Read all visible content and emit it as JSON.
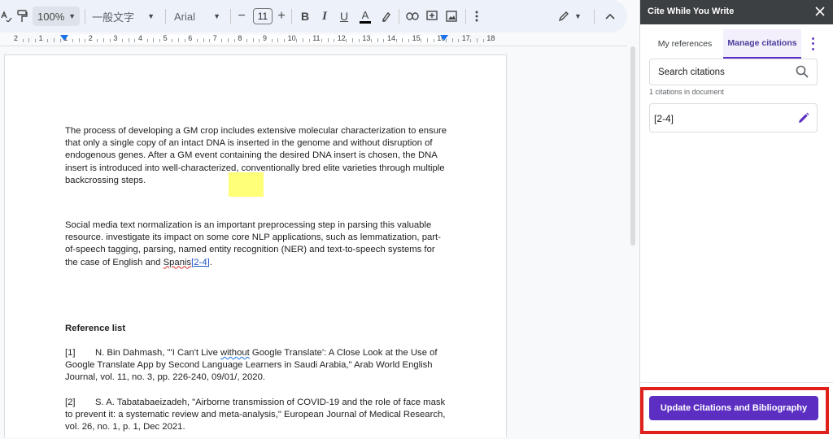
{
  "toolbar": {
    "zoom": "100%",
    "paragraph_style": "一般文字",
    "font": "Arial",
    "font_size": "11",
    "bold": "B",
    "italic": "I",
    "underline": "U",
    "text_color": "A"
  },
  "ruler": {
    "ticks": [
      "2",
      "1",
      "1",
      "2",
      "3",
      "4",
      "5",
      "6",
      "7",
      "8",
      "9",
      "10",
      "11",
      "12",
      "13",
      "14",
      "15",
      "16",
      "17",
      "18"
    ]
  },
  "document": {
    "paragraph1": "The process of developing a GM crop includes extensive molecular characterization to ensure that only a single copy of an intact DNA is inserted in the genome and without disruption of endogenous genes. After a GM event containing the desired DNA insert is chosen, the DNA insert is introduced into well-characterized, conventionally bred elite varieties through multiple backcrossing steps.",
    "paragraph2_before": "Social media text normalization is an important preprocessing step in parsing this valuable resource. investigate its impact on some core NLP applications, such as lemmatization, part-of-speech tagging, parsing, named entity recognition (NER) and text-to-speech systems for the case of English and ",
    "paragraph2_misspelled": "Spanis",
    "paragraph2_citation": "[2-4]",
    "paragraph2_end": ".",
    "reference_title": "Reference list",
    "references": [
      {
        "num": "[1]",
        "before": "N. Bin Dahmash, \"'I Can't Live ",
        "flagged": "without",
        "after": " Google Translate': A Close Look at the Use of Google Translate App by Second Language Learners in Saudi Arabia,\" Arab World English Journal, vol. 11, no. 3, pp. 226-240, 09/01/, 2020."
      },
      {
        "num": "[2]",
        "before": "S. A. Tabatabaeizadeh, \"Airborne transmission of COVID-19 and the role of face mask to prevent it: a systematic review and meta-analysis,\" European Journal of Medical Research, vol. 26, no. 1, p. 1, Dec 2021.",
        "flagged": "",
        "after": ""
      }
    ]
  },
  "panel": {
    "title": "Cite While You Write",
    "tabs": [
      "My references",
      "Manage citations"
    ],
    "active_tab": "Manage citations",
    "search_placeholder": "Search citations",
    "citation_count": "1 citations in document",
    "citations": [
      "[2-4]"
    ],
    "update_button": "Update Citations and Bibliography"
  },
  "colors": {
    "accent": "#5c2fc2",
    "highlight_outline": "#e0211b",
    "text_highlight": "#ffff60"
  }
}
